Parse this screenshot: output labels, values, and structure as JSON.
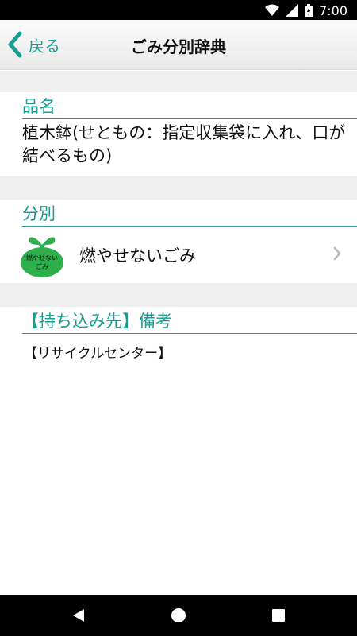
{
  "status_bar": {
    "time": "7:00",
    "icons": [
      "wifi-icon",
      "signal-icon",
      "battery-icon"
    ]
  },
  "toolbar": {
    "back_label": "戻る",
    "title": "ごみ分別辞典",
    "accent_color": "#1a9e8f"
  },
  "sections": {
    "item": {
      "header": "品名",
      "value": "植木鉢(せともの：指定収集袋に入れ、口が結べるもの)"
    },
    "category": {
      "header": "分別",
      "bag_text_line1": "燃やせない",
      "bag_text_line2": "ごみ",
      "value": "燃やせないごみ",
      "bag_color": "#2db04b"
    },
    "notes": {
      "header": "【持ち込み先】備考",
      "value": "【リサイクルセンター】"
    }
  },
  "nav_bar": {
    "buttons": [
      "back-triangle-icon",
      "home-circle-icon",
      "recents-square-icon"
    ]
  }
}
